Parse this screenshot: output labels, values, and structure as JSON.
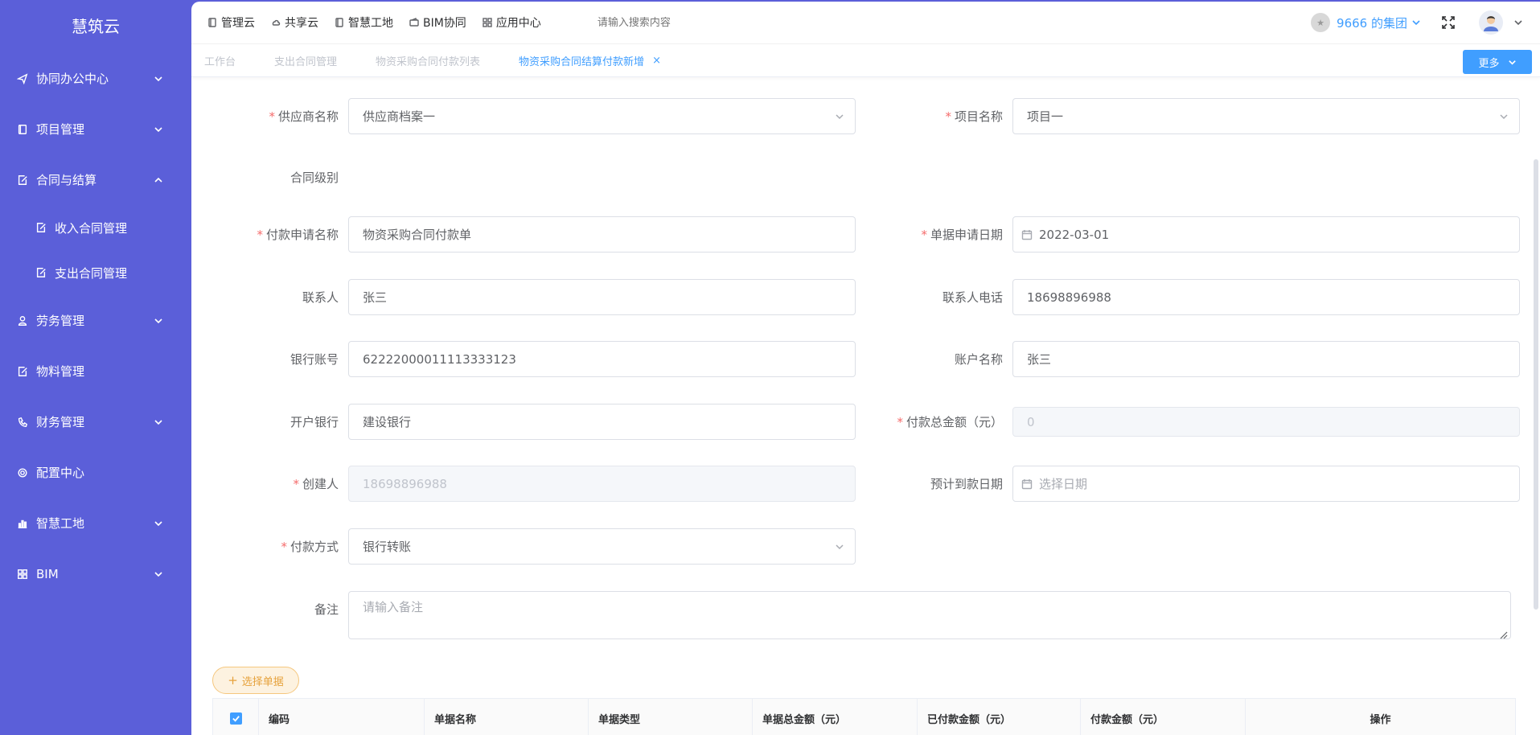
{
  "app": {
    "logo": "慧筑云"
  },
  "sidebar": {
    "items": [
      {
        "label": "协同办公中心",
        "icon": "send-icon",
        "expanded": false,
        "has_children": true
      },
      {
        "label": "项目管理",
        "icon": "book-icon",
        "expanded": false,
        "has_children": true
      },
      {
        "label": "合同与结算",
        "icon": "edit-icon",
        "expanded": true,
        "has_children": true
      },
      {
        "label": "劳务管理",
        "icon": "user-icon",
        "expanded": false,
        "has_children": true
      },
      {
        "label": "物料管理",
        "icon": "edit-icon",
        "expanded": false,
        "has_children": false
      },
      {
        "label": "财务管理",
        "icon": "phone-icon",
        "expanded": false,
        "has_children": true
      },
      {
        "label": "配置中心",
        "icon": "gear-icon",
        "expanded": false,
        "has_children": false
      },
      {
        "label": "智慧工地",
        "icon": "bar-chart-icon",
        "expanded": false,
        "has_children": true
      },
      {
        "label": "BIM",
        "icon": "grid-icon",
        "expanded": false,
        "has_children": true
      }
    ],
    "sub_items": [
      {
        "label": "收入合同管理",
        "icon": "edit-icon"
      },
      {
        "label": "支出合同管理",
        "icon": "edit-icon"
      }
    ]
  },
  "topbar": {
    "links": [
      {
        "label": "管理云",
        "icon": "doc-icon"
      },
      {
        "label": "共享云",
        "icon": "cloud-icon"
      },
      {
        "label": "智慧工地",
        "icon": "doc-icon"
      },
      {
        "label": "BIM协同",
        "icon": "wallet-icon"
      },
      {
        "label": "应用中心",
        "icon": "grid-icon"
      }
    ],
    "search_placeholder": "请输入搜索内容",
    "org_name": "9666 的集团",
    "accent": "#409eff"
  },
  "tabs": [
    {
      "label": "工作台",
      "active": false
    },
    {
      "label": "支出合同管理",
      "active": false
    },
    {
      "label": "物资采购合同付款列表",
      "active": false
    },
    {
      "label": "物资采购合同结算付款新增",
      "active": true,
      "closable": true,
      "close": "×"
    }
  ],
  "more_button": "更多",
  "form": {
    "supplier": {
      "label": "供应商名称",
      "required": true,
      "value": "供应商档案一"
    },
    "project": {
      "label": "项目名称",
      "required": true,
      "value": "项目一"
    },
    "contract_level": {
      "label": "合同级别"
    },
    "payment_name": {
      "label": "付款申请名称",
      "required": true,
      "value": "物资采购合同付款单"
    },
    "apply_date": {
      "label": "单据申请日期",
      "required": true,
      "value": "2022-03-01"
    },
    "contact": {
      "label": "联系人",
      "value": "张三"
    },
    "contact_phone": {
      "label": "联系人电话",
      "value": "18698896988"
    },
    "bank_account": {
      "label": "银行账号",
      "value": "62222000011113333123"
    },
    "account_name": {
      "label": "账户名称",
      "value": "张三"
    },
    "bank": {
      "label": "开户银行",
      "value": "建设银行"
    },
    "total_amount": {
      "label": "付款总金额（元）",
      "required": true,
      "value": "0"
    },
    "creator": {
      "label": "创建人",
      "required": true,
      "value": "18698896988"
    },
    "expected_date": {
      "label": "预计到款日期",
      "placeholder": "选择日期"
    },
    "payment_method": {
      "label": "付款方式",
      "required": true,
      "value": "银行转账"
    },
    "remark": {
      "label": "备注",
      "placeholder": "请输入备注"
    }
  },
  "select_docs_button": "选择单据",
  "table": {
    "headers": [
      "编码",
      "单据名称",
      "单据类型",
      "单据总金额（元）",
      "已付款金额（元）",
      "付款金额（元）",
      "操作"
    ]
  }
}
